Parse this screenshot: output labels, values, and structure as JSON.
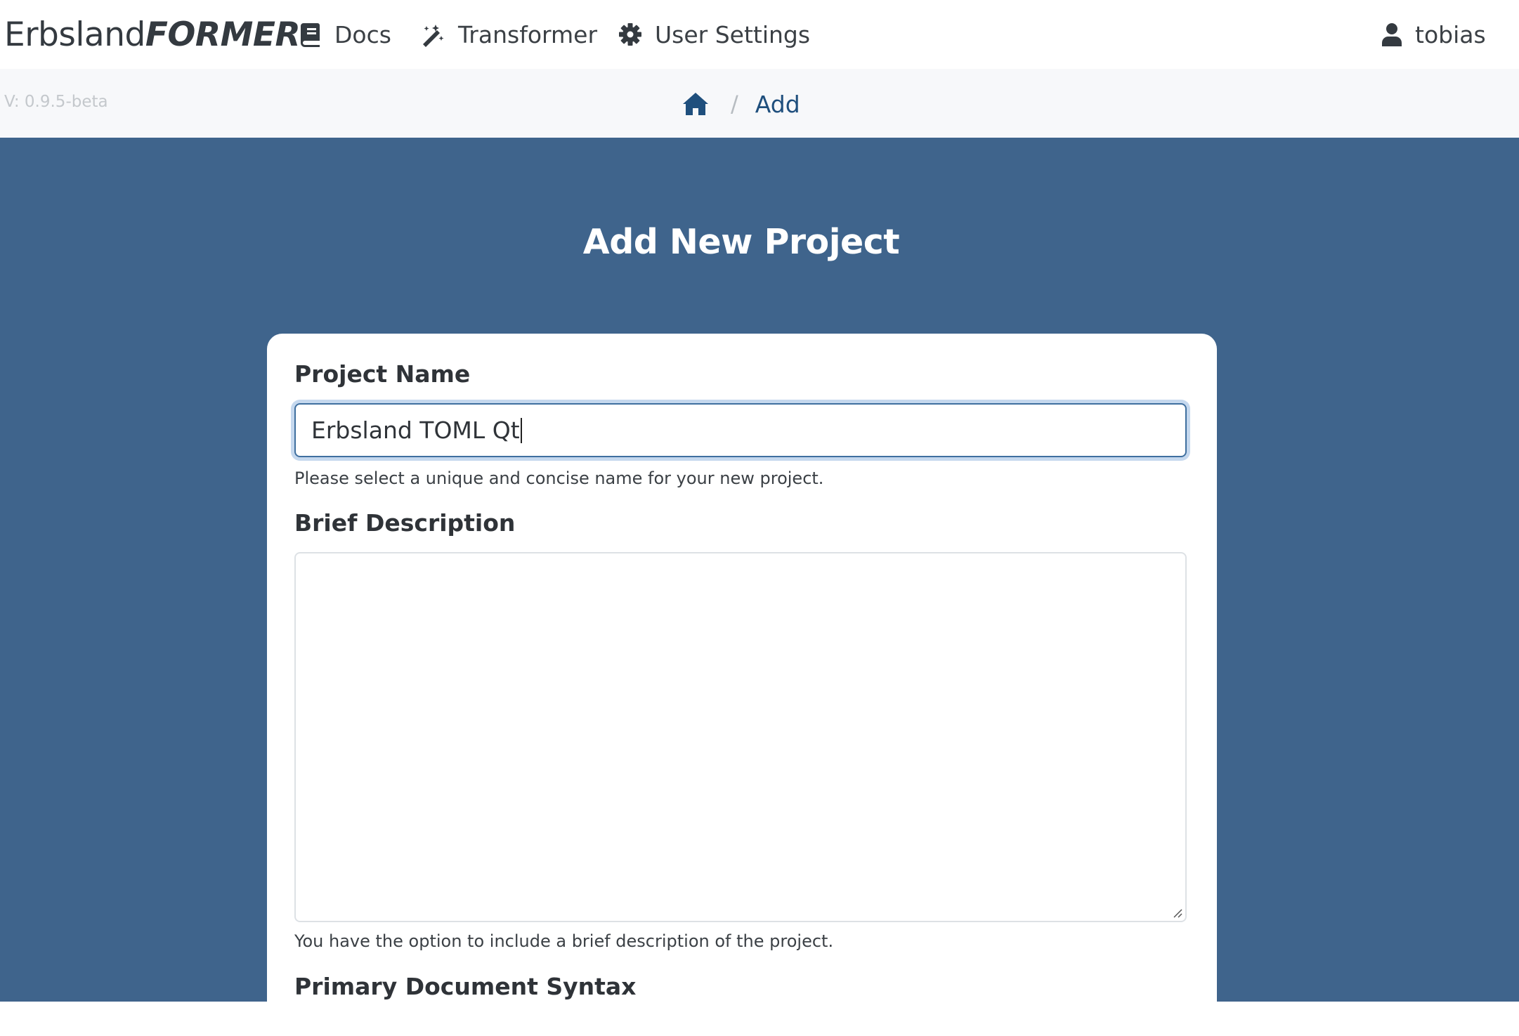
{
  "brand": {
    "part1": "Erbsland",
    "part2": "FORMER"
  },
  "nav": {
    "docs_label": "Docs",
    "transformer_label": "Transformer",
    "settings_label": "User Settings",
    "user_label": "tobias"
  },
  "version": "V: 0.9.5-beta",
  "breadcrumb": {
    "separator": "/",
    "current": "Add"
  },
  "page": {
    "title": "Add New Project"
  },
  "form": {
    "name_label": "Project Name",
    "name_value": "Erbsland TOML Qt",
    "name_help": "Please select a unique and concise name for your new project.",
    "description_label": "Brief Description",
    "description_value": "",
    "description_help": "You have the option to include a brief description of the project.",
    "syntax_label": "Primary Document Syntax"
  },
  "colors": {
    "hero_background": "#3f648c",
    "accent": "#1f4f7d",
    "focus_ring": "#c5d8ee"
  },
  "icons": {
    "docs": "book-icon",
    "transformer": "magic-wand-icon",
    "settings": "gear-icon",
    "user": "user-icon",
    "home": "home-icon"
  }
}
